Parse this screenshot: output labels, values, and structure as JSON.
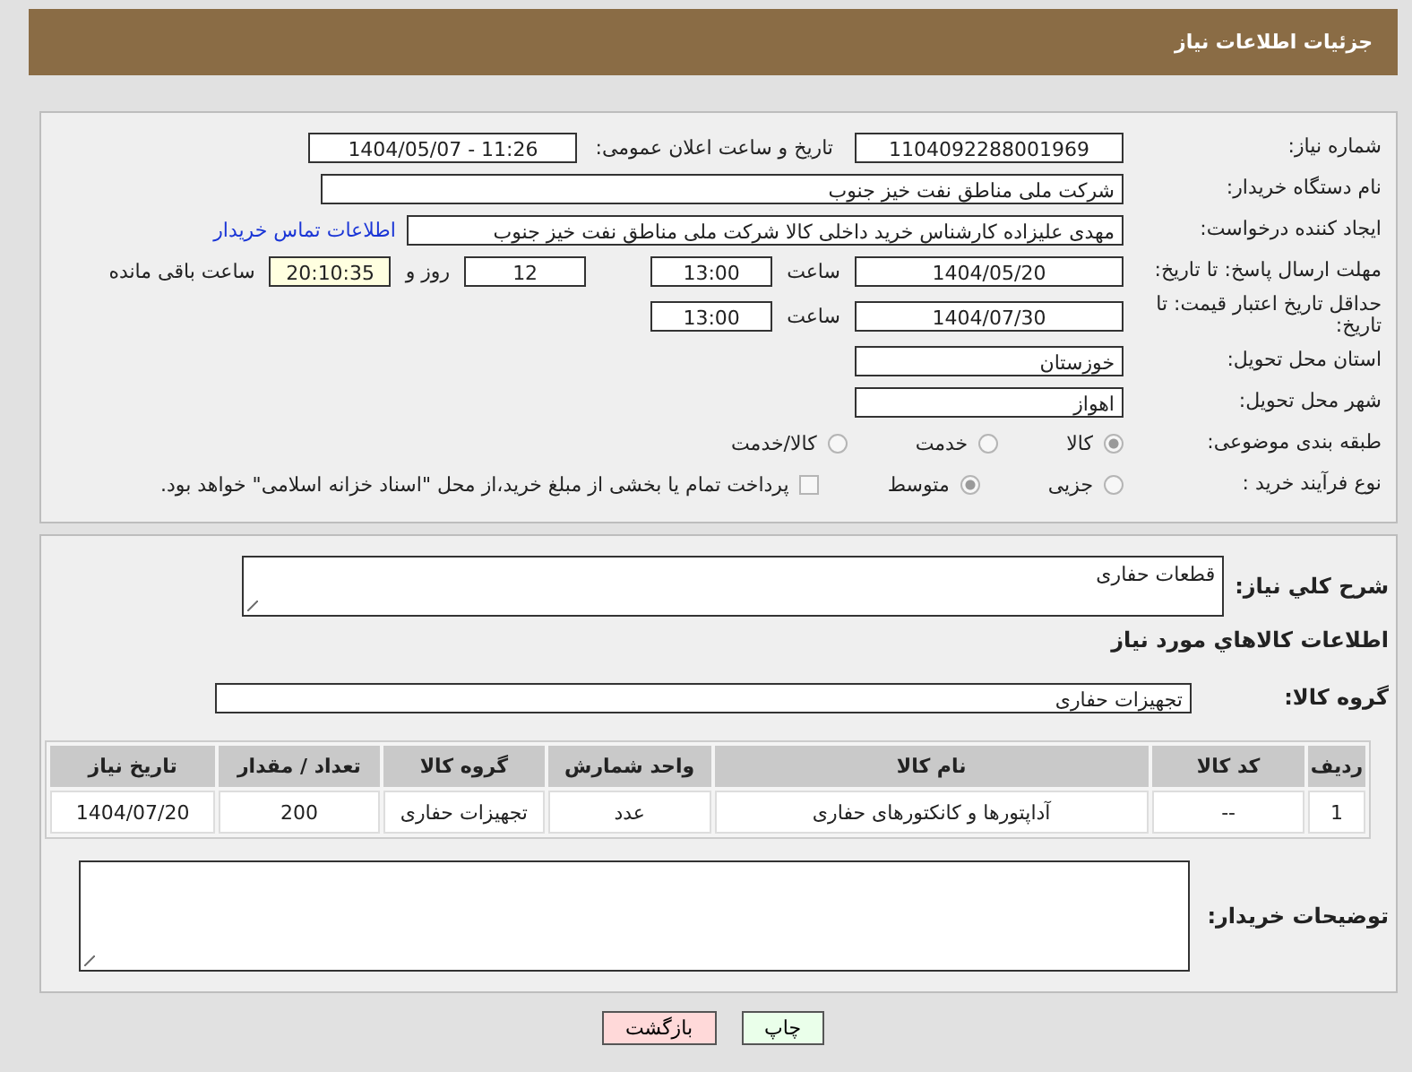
{
  "header": {
    "title": "جزئیات اطلاعات نیاز"
  },
  "need_number": {
    "label": "شماره نیاز:",
    "value": "1104092288001969"
  },
  "announce": {
    "label": "تاریخ و ساعت اعلان عمومی:",
    "value": "1404/05/07 - 11:26"
  },
  "buyer_org": {
    "label": "نام دستگاه خریدار:",
    "value": "شرکت ملی مناطق نفت خیز جنوب"
  },
  "creator": {
    "label": "ایجاد کننده درخواست:",
    "value": "مهدی  علیزاده  کارشناس خرید داخلی کالا شرکت ملی مناطق نفت خیز جنوب",
    "link": "اطلاعات تماس خریدار"
  },
  "deadline": {
    "label": "مهلت ارسال پاسخ: تا تاریخ:",
    "date": "1404/05/20",
    "time_label": "ساعت",
    "time": "13:00",
    "days": "12",
    "days_label": "روز و",
    "remaining": "20:10:35",
    "remaining_label": "ساعت باقی مانده"
  },
  "validity": {
    "label": "حداقل تاریخ اعتبار قیمت: تا تاریخ:",
    "date": "1404/07/30",
    "time_label": "ساعت",
    "time": "13:00"
  },
  "province": {
    "label": "استان محل تحویل:",
    "value": "خوزستان"
  },
  "city": {
    "label": "شهر محل تحویل:",
    "value": "اهواز"
  },
  "category": {
    "label": "طبقه بندی موضوعی:",
    "options": [
      {
        "label": "کالا",
        "selected": true
      },
      {
        "label": "خدمت",
        "selected": false
      },
      {
        "label": "کالا/خدمت",
        "selected": false
      }
    ]
  },
  "process": {
    "label": "نوع فرآیند خرید :",
    "options": [
      {
        "label": "جزیی",
        "selected": false
      },
      {
        "label": "متوسط",
        "selected": true
      }
    ],
    "treasury": {
      "label": "پرداخت تمام یا بخشی از مبلغ خرید،از محل \"اسناد خزانه اسلامی\" خواهد بود.",
      "checked": false
    }
  },
  "description": {
    "label": "شرح کلي نياز:",
    "value": "قطعات حفاری"
  },
  "goods_title": "اطلاعات کالاهاي مورد نياز",
  "goods_group": {
    "label": "گروه کالا:",
    "value": "تجهیزات حفاری"
  },
  "table": {
    "columns": [
      "ردیف",
      "کد کالا",
      "نام کالا",
      "واحد شمارش",
      "گروه کالا",
      "تعداد / مقدار",
      "تاریخ نیاز"
    ],
    "rows": [
      [
        "1",
        "--",
        "آداپتورها و کانکتورهای حفاری",
        "عدد",
        "تجهیزات حفاری",
        "200",
        "1404/07/20"
      ]
    ]
  },
  "buyer_notes": {
    "label": "توضیحات خریدار:"
  },
  "buttons": [
    {
      "label": "چاپ",
      "kind": "print"
    },
    {
      "label": "بازگشت",
      "kind": "back"
    }
  ]
}
